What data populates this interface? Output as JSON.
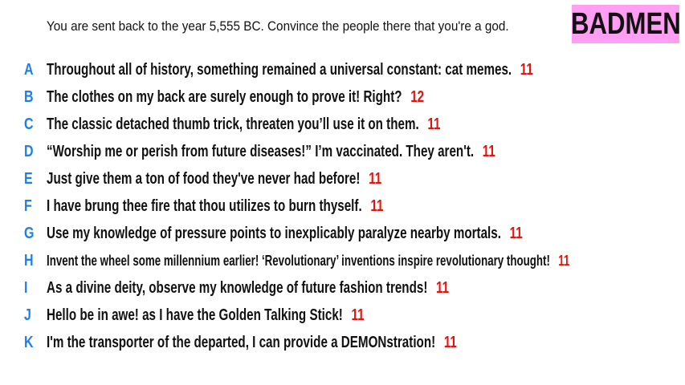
{
  "prompt": "You are sent back to the year 5,555 BC. Convince the people there that you're a god.",
  "logo": "BADMEN",
  "colors": {
    "logo_background": "#ff9ef2",
    "letter": "#1f7fe6",
    "score": "#e8120c"
  },
  "answers": [
    {
      "letter": "A",
      "text": "Throughout all of history, something remained a universal constant: cat memes.",
      "score": "11"
    },
    {
      "letter": "B",
      "text": "The clothes on my back are surely enough to prove it! Right?",
      "score": "12"
    },
    {
      "letter": "C",
      "text": "The classic detached thumb trick, threaten you’ll use it on them.",
      "score": "11"
    },
    {
      "letter": "D",
      "text": "“Worship me or perish from future diseases!” I’m vaccinated. They aren't.",
      "score": "11"
    },
    {
      "letter": "E",
      "text": "Just give them a ton of food they've never had before!",
      "score": "11"
    },
    {
      "letter": "F",
      "text": "I have brung thee fire that thou utilizes to burn thyself.",
      "score": "11"
    },
    {
      "letter": "G",
      "text": "Use my knowledge of pressure points to inexplicably paralyze nearby mortals.",
      "score": "11"
    },
    {
      "letter": "H",
      "text": "Invent the wheel some millennium earlier! ‘Revolutionary’ inventions inspire revolutionary thought!",
      "score": "11"
    },
    {
      "letter": "I",
      "text": "As a divine deity, observe my knowledge of future fashion trends!",
      "score": "11"
    },
    {
      "letter": "J",
      "text": "Hello be in awe! as I have the Golden Talking Stick!",
      "score": "11"
    },
    {
      "letter": "K",
      "text": "I'm the transporter of the departed, I can provide a DEMONstration!",
      "score": "11"
    }
  ]
}
